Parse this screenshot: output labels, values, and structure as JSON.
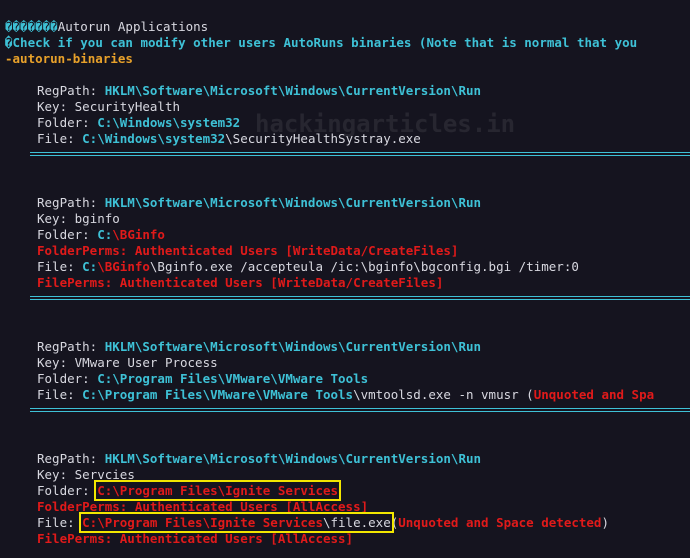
{
  "header": {
    "title_prefix": "�������",
    "title": "Autorun Applications",
    "check_line": "Check if you can modify other users AutoRuns binaries (Note that is normal that you",
    "check_prefix": "�",
    "link": "-autorun-binaries"
  },
  "watermark": "hackingarticles.in",
  "labels": {
    "regpath": "RegPath: ",
    "key": "Key: ",
    "folder": "Folder: ",
    "file": "File: ",
    "folderperms": "FolderPerms: Authenticated Users [WriteData/CreateFiles]",
    "fileperms": "FilePerms: Authenticated Users [WriteData/CreateFiles]",
    "folderperms_all": "FolderPerms: Authenticated Users [AllAccess]",
    "fileperms_all": "FilePerms: Authenticated Users [AllAccess]"
  },
  "entries": [
    {
      "regpath": "HKLM\\Software\\Microsoft\\Windows\\CurrentVersion\\Run",
      "key": "SecurityHealth",
      "folder": "C:\\Windows\\system32",
      "file_path": "C:\\Windows\\system32",
      "file_rest": "\\SecurityHealthSystray.exe"
    },
    {
      "regpath": "HKLM\\Software\\Microsoft\\Windows\\CurrentVersion\\Run",
      "key": "bginfo",
      "folder_c": "C:",
      "folder_rest": "\\BGinfo",
      "file_c": "C:",
      "file_folder": "\\BGinfo",
      "file_rest": "\\Bginfo.exe /accepteula /ic:\\bginfo\\bgconfig.bgi /timer:0"
    },
    {
      "regpath": "HKLM\\Software\\Microsoft\\Windows\\CurrentVersion\\Run",
      "key": "VMware User Process",
      "folder": "C:\\Program Files\\VMware\\VMware Tools",
      "file_path": "C:\\Program Files\\VMware\\VMware Tools",
      "file_rest": "\\vmtoolsd.exe -n vmusr (",
      "file_note": "Unquoted and Spa"
    },
    {
      "regpath": "HKLM\\Software\\Microsoft\\Windows\\CurrentVersion\\Run",
      "key": "Servcies",
      "folder": "C:\\Program Files\\Ignite Services",
      "file_path": "C:\\Program Files\\Ignite Services",
      "file_rest": "\\file.exe",
      "file_open": "(",
      "file_note": "Unquoted and Space detected",
      "file_close": ")"
    }
  ]
}
